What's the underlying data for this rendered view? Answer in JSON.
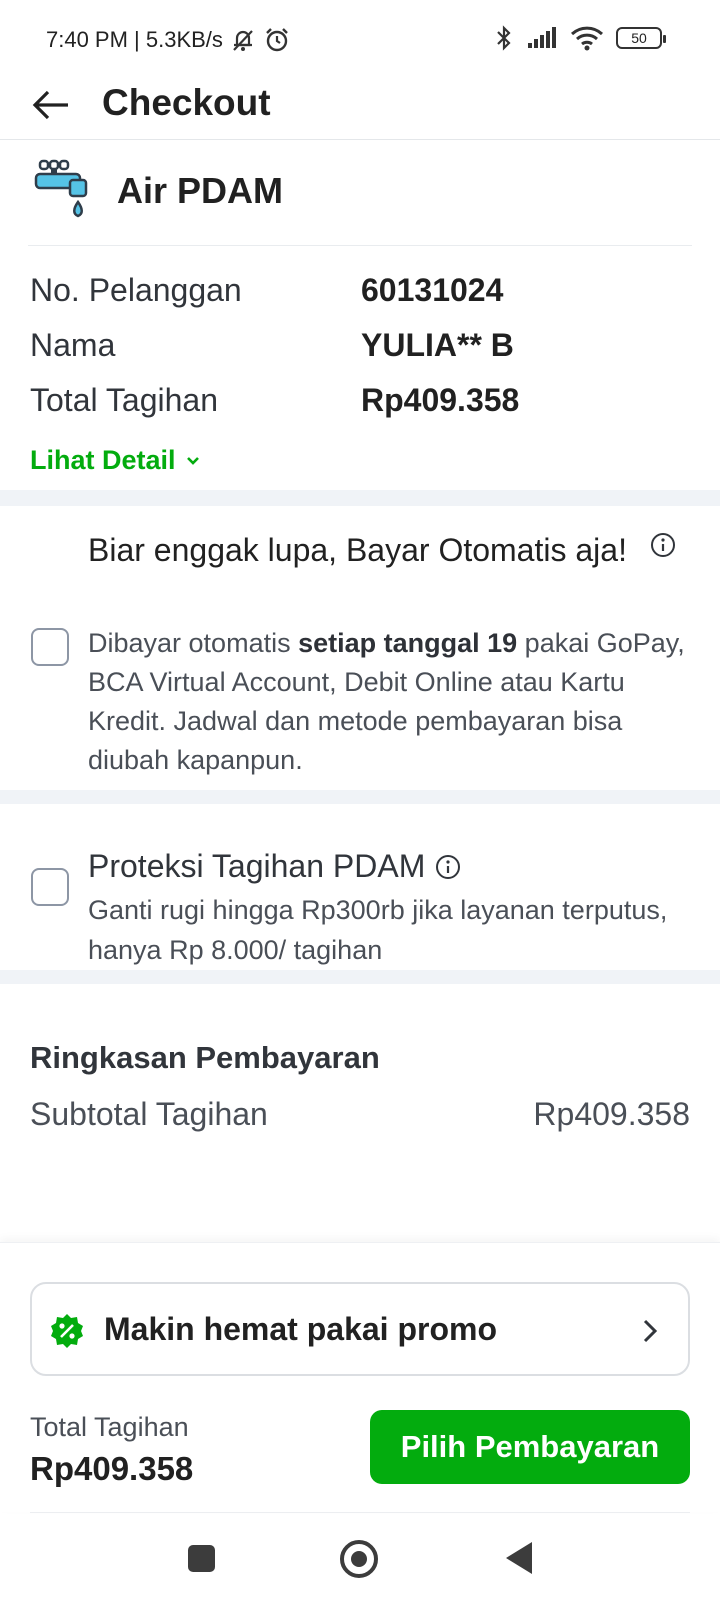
{
  "status_bar": {
    "time_speed": "7:40 PM | 5.3KB/s",
    "battery": "50",
    "icons": [
      "mute-alarm-icon",
      "alarm-clock-icon",
      "bluetooth-icon",
      "signal-icon",
      "wifi-icon",
      "battery-icon"
    ]
  },
  "header": {
    "title": "Checkout",
    "back_icon": "arrow-left-icon"
  },
  "product": {
    "name": "Air PDAM",
    "icon": "water-tap-icon"
  },
  "details": [
    {
      "label": "No. Pelanggan",
      "value": "60131024"
    },
    {
      "label": "Nama",
      "value": "YULIA** B"
    },
    {
      "label": "Total Tagihan",
      "value": "Rp409.358"
    }
  ],
  "lihat_detail": "Lihat Detail",
  "autopay": {
    "title": "Biar enggak lupa, Bayar Otomatis aja!",
    "desc_pre": "Dibayar otomatis ",
    "desc_bold": "setiap tanggal 19",
    "desc_post": " pakai GoPay, BCA Virtual Account, Debit Online atau Kartu Kredit. Jadwal dan metode pembayaran bisa diubah kapanpun.",
    "checked": false
  },
  "protection": {
    "title": "Proteksi Tagihan PDAM",
    "desc": "Ganti rugi hingga Rp300rb jika layanan terputus, hanya Rp 8.000/ tagihan",
    "checked": false
  },
  "summary": {
    "title": "Ringkasan Pembayaran",
    "subtotal_label": "Subtotal Tagihan",
    "subtotal_value": "Rp409.358"
  },
  "promo": {
    "label": "Makin hemat pakai promo"
  },
  "footer": {
    "total_label": "Total Tagihan",
    "total_value": "Rp409.358",
    "pay_button": "Pilih Pembayaran"
  },
  "colors": {
    "brand_green": "#03ac0e",
    "separator": "#f0f3f7",
    "text_primary": "#212121"
  }
}
